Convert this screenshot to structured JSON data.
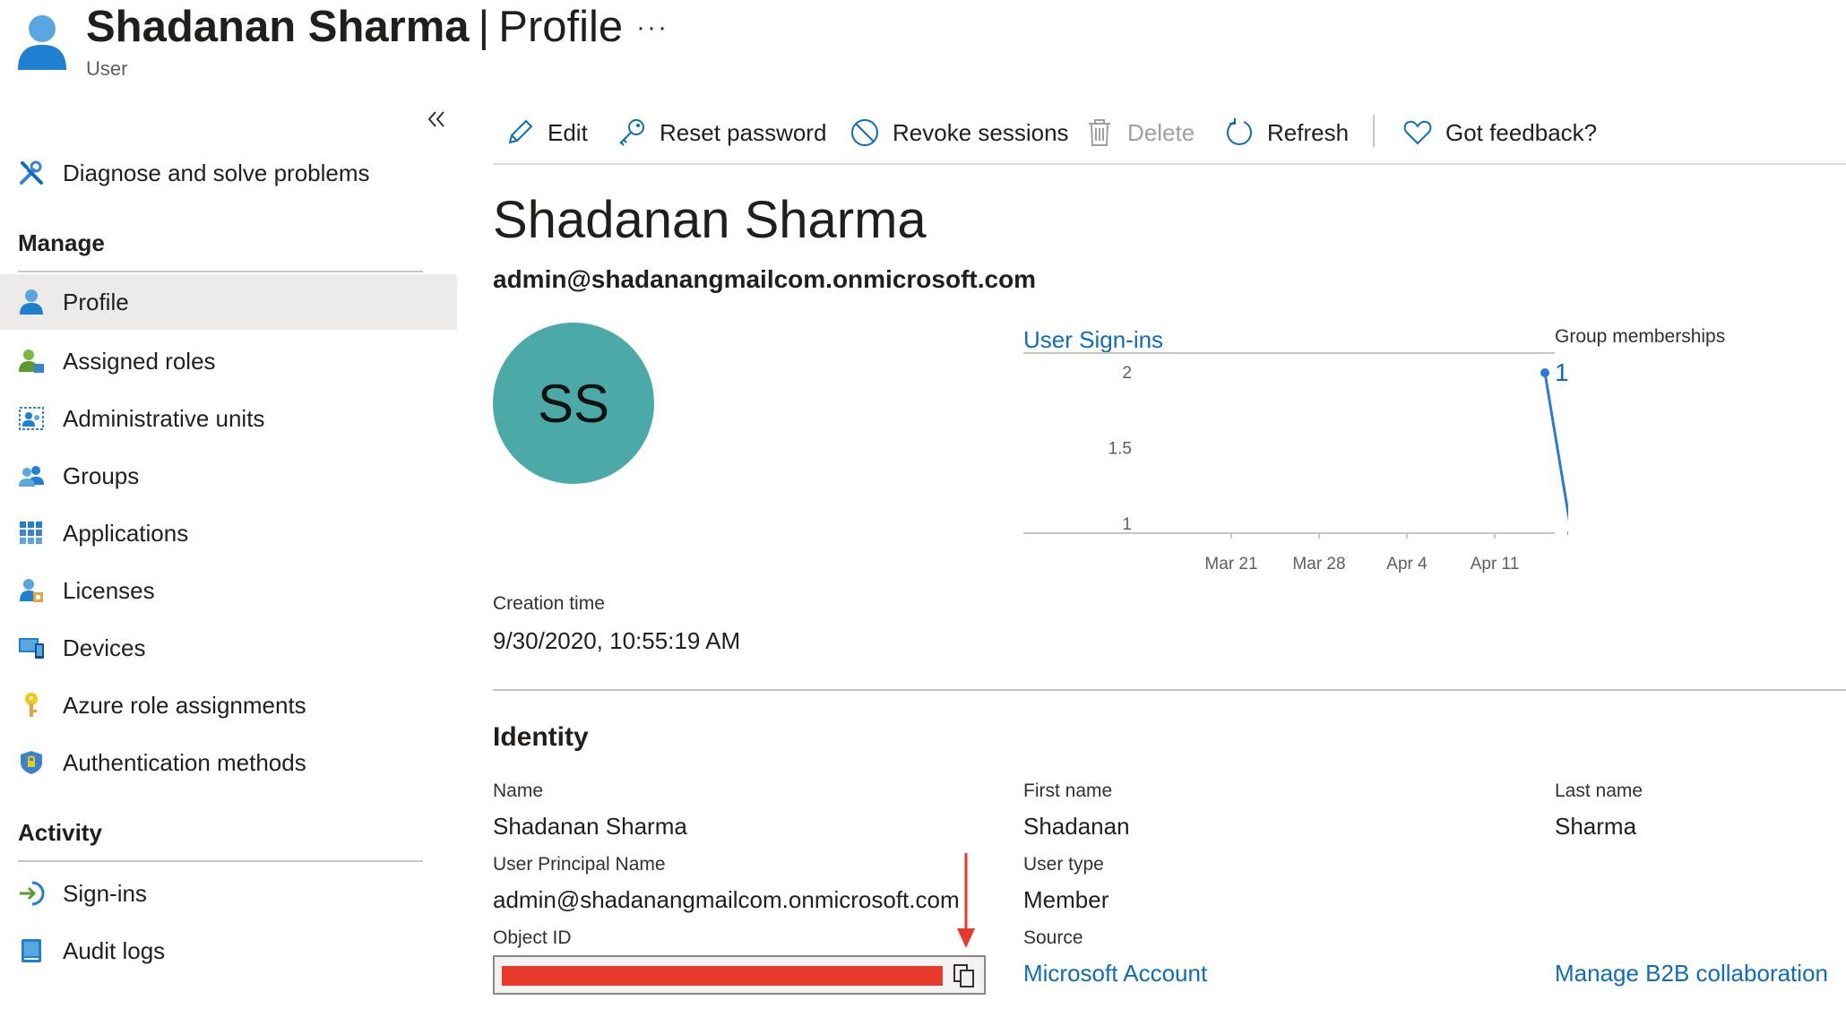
{
  "header": {
    "name": "Shadanan Sharma",
    "separator": "|",
    "page": "Profile",
    "subtitle": "User",
    "more": "···"
  },
  "sidebar": {
    "collapse_icon": "double-chevron-left-icon",
    "top_item": {
      "label": "Diagnose and solve problems",
      "icon": "wrench-icon"
    },
    "manage_header": "Manage",
    "manage_items": [
      {
        "label": "Profile",
        "icon": "user-icon",
        "active": true
      },
      {
        "label": "Assigned roles",
        "icon": "user-role-icon"
      },
      {
        "label": "Administrative units",
        "icon": "admin-units-icon"
      },
      {
        "label": "Groups",
        "icon": "groups-icon"
      },
      {
        "label": "Applications",
        "icon": "grid-icon"
      },
      {
        "label": "Licenses",
        "icon": "license-icon"
      },
      {
        "label": "Devices",
        "icon": "devices-icon"
      },
      {
        "label": "Azure role assignments",
        "icon": "key-icon"
      },
      {
        "label": "Authentication methods",
        "icon": "shield-icon"
      }
    ],
    "activity_header": "Activity",
    "activity_items": [
      {
        "label": "Sign-ins",
        "icon": "sign-in-icon"
      },
      {
        "label": "Audit logs",
        "icon": "audit-log-icon"
      }
    ]
  },
  "toolbar": {
    "edit": "Edit",
    "reset_password": "Reset password",
    "revoke_sessions": "Revoke sessions",
    "delete": "Delete",
    "refresh": "Refresh",
    "feedback": "Got feedback?"
  },
  "profile": {
    "display_name": "Shadanan Sharma",
    "upn": "admin@shadanangmailcom.onmicrosoft.com",
    "initials": "SS",
    "avatar_color": "#4ba9a8",
    "creation_time_label": "Creation time",
    "creation_time": "9/30/2020, 10:55:19 AM",
    "group_memberships_label": "Group memberships",
    "group_memberships": "1"
  },
  "chart_data": {
    "type": "line",
    "title": "User Sign-ins",
    "x_ticks": [
      "Mar 21",
      "Mar 28",
      "Apr 4",
      "Apr 11"
    ],
    "y_ticks": [
      "2",
      "1.5",
      "1"
    ],
    "ylim": [
      1,
      2
    ],
    "series": [
      {
        "points": [
          {
            "x": "Apr 15",
            "y": 2
          },
          {
            "x": "Apr 17",
            "y": 1
          }
        ]
      }
    ],
    "color": "#2a7bd4",
    "grid": false
  },
  "identity": {
    "header": "Identity",
    "name_label": "Name",
    "name": "Shadanan Sharma",
    "first_name_label": "First name",
    "first_name": "Shadanan",
    "last_name_label": "Last name",
    "last_name": "Sharma",
    "upn_label": "User Principal Name",
    "upn": "admin@shadanangmailcom.onmicrosoft.com",
    "user_type_label": "User type",
    "user_type": "Member",
    "object_id_label": "Object ID",
    "source_label": "Source",
    "source": "Microsoft Account",
    "b2b_link": "Manage B2B collaboration",
    "redaction_color": "#e8392d"
  }
}
